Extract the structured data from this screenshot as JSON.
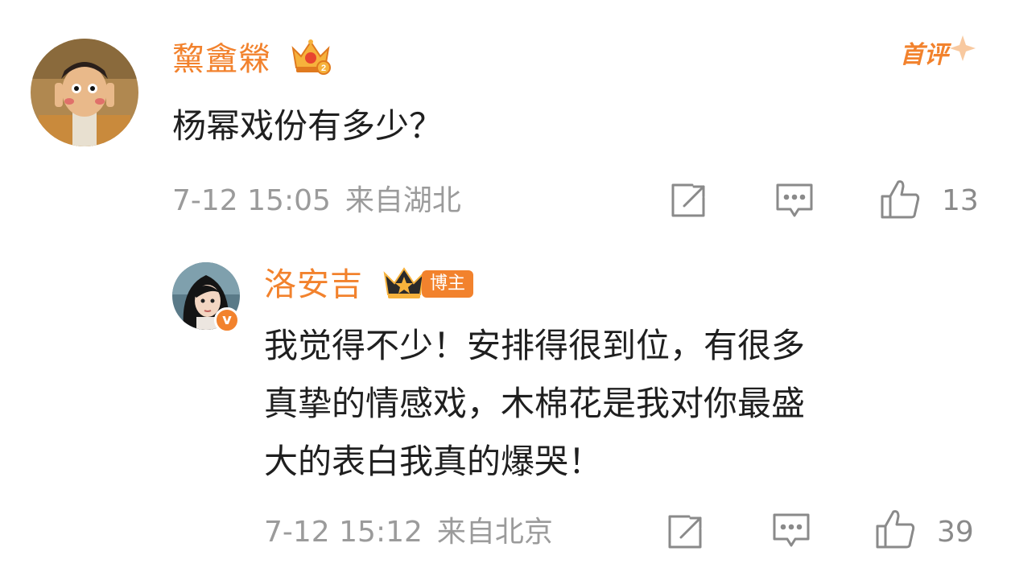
{
  "comment": {
    "username": "黧盦檾",
    "text": "杨幂戏份有多少？",
    "date": "7-12 15:05",
    "location": "来自湖北",
    "likes": "13",
    "badge": "首评",
    "avatar_icon": "cartoon-boy-avatar",
    "crown_icon": "fan-crown-icon-level-2"
  },
  "reply": {
    "username": "洛安吉",
    "lines": [
      "我觉得不少！安排得很到位，有很多",
      "真挚的情感戏，木棉花是我对你最盛",
      "大的表白我真的爆哭！"
    ],
    "date": "7-12 15:12",
    "location": "来自北京",
    "likes": "39",
    "author_badge": "博主",
    "verified_mark": "v",
    "avatar_icon": "anime-girl-avatar",
    "crown_icon": "fan-crown-icon"
  },
  "colors": {
    "accent": "#f2822d",
    "text": "#1f1f1f",
    "meta": "#9b9b9b"
  }
}
